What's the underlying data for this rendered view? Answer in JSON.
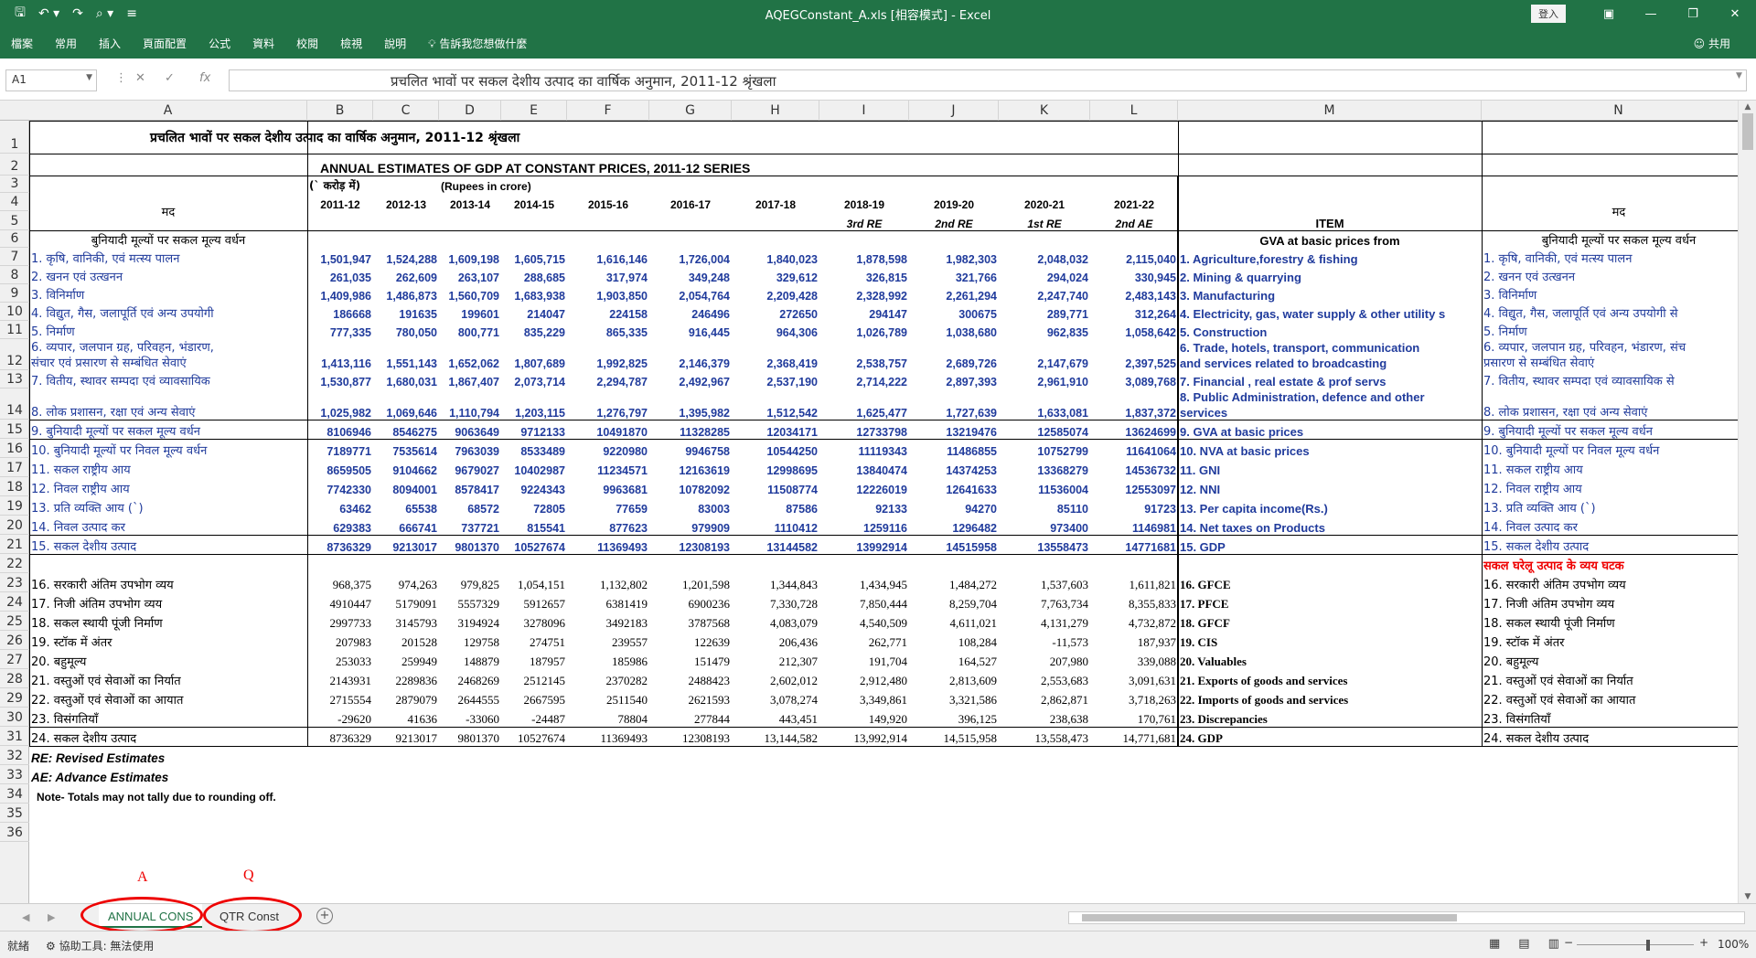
{
  "app": {
    "title": "AQEGConstant_A.xls [相容模式] - Excel",
    "signin": "登入",
    "share": "共用",
    "qa_icons": [
      "save-icon",
      "undo-icon",
      "redo-icon",
      "search-icon",
      "customize-icon"
    ],
    "window_controls": [
      "ribbon-display-icon",
      "minimize-icon",
      "restore-icon",
      "close-icon"
    ]
  },
  "ribbon": {
    "tabs": [
      "檔案",
      "常用",
      "插入",
      "頁面配置",
      "公式",
      "資料",
      "校閱",
      "檢視",
      "說明",
      "告訴我您想做什麼"
    ]
  },
  "formulabar": {
    "namebox": "A1",
    "formula": "प्रचलित भावों पर सकल देशीय उत्पाद का वार्षिक अनुमान, 2011-12 श्रृंखला"
  },
  "columns": [
    "A",
    "B",
    "C",
    "D",
    "E",
    "F",
    "G",
    "H",
    "I",
    "J",
    "K",
    "L",
    "M",
    "N"
  ],
  "rows": [
    "1",
    "2",
    "3",
    "4",
    "5",
    "6",
    "7",
    "8",
    "9",
    "10",
    "11",
    "12",
    "13",
    "14",
    "15",
    "16",
    "17",
    "18",
    "19",
    "20",
    "21",
    "22",
    "23",
    "24",
    "25",
    "26",
    "27",
    "28",
    "29",
    "30",
    "31",
    "32",
    "33",
    "34",
    "35",
    "36"
  ],
  "sheet": {
    "title_hi": "प्रचलित भावों पर सकल देशीय उत्पाद का वार्षिक अनुमान, 2011-12 श्रृंखला",
    "title_en": "ANNUAL ESTIMATES OF GDP AT CONSTANT PRICES,  2011-12 SERIES",
    "unit_hi": "(` करोड़ में)",
    "unit_en": "(Rupees in crore)",
    "mad": "मद",
    "item": "ITEM",
    "years": [
      "2011-12",
      "2012-13",
      "2013-14",
      "2014-15",
      "2015-16",
      "2016-17",
      "2017-18",
      "2018-19",
      "2019-20",
      "2020-21",
      "2021-22"
    ],
    "year_notes": [
      "",
      "",
      "",
      "",
      "",
      "",
      "",
      "3rd RE",
      "2nd RE",
      "1st RE",
      "2nd AE"
    ],
    "gva_hi": "बुनियादी मूल्यों पर सकल मूल्य वर्धन",
    "gva_en": "GVA at basic prices from",
    "section2_hi": "सकल घरेलू उत्पाद के व्यय घटक",
    "rows": [
      {
        "hi": "1. कृषि, वानिकी, एवं मत्स्य पालन",
        "hi_n": "1. कृषि, वानिकी, एवं मत्स्य पालन",
        "en": "1.  Agriculture,forestry & fishing",
        "vals": [
          "1,501,947",
          "1,524,288",
          "1,609,198",
          "1,605,715",
          "1,616,146",
          "1,726,004",
          "1,840,023",
          "1,878,598",
          "1,982,303",
          "2,048,032",
          "2,115,040"
        ]
      },
      {
        "hi": "2. खनन एवं उत्खनन",
        "hi_n": "2. खनन एवं उत्खनन",
        "en": "2.  Mining & quarrying",
        "vals": [
          "261,035",
          "262,609",
          "263,107",
          "288,685",
          "317,974",
          "349,248",
          "329,612",
          "326,815",
          "321,766",
          "294,024",
          "330,945"
        ]
      },
      {
        "hi": "3. विनिर्माण",
        "hi_n": "3. विनिर्माण",
        "en": "3.  Manufacturing",
        "vals": [
          "1,409,986",
          "1,486,873",
          "1,560,709",
          "1,683,938",
          "1,903,850",
          "2,054,764",
          "2,209,428",
          "2,328,992",
          "2,261,294",
          "2,247,740",
          "2,483,143"
        ]
      },
      {
        "hi": "4. विद्युत, गैस, जलापूर्ति एवं अन्य उपयोगी",
        "hi_n": "4. विद्युत, गैस, जलापूर्ति एवं अन्य उपयोगी से",
        "en": "4.  Electricity, gas, water supply & other utility s",
        "vals": [
          "186668",
          "191635",
          "199601",
          "214047",
          "224158",
          "246496",
          "272650",
          "294147",
          "300675",
          "289,771",
          "312,264"
        ]
      },
      {
        "hi": "5. निर्माण",
        "hi_n": "5. निर्माण",
        "en": "5.  Construction",
        "vals": [
          "777,335",
          "780,050",
          "800,771",
          "835,229",
          "865,335",
          "916,445",
          "964,306",
          "1,026,789",
          "1,038,680",
          "962,835",
          "1,058,642"
        ]
      },
      {
        "hi": "6. व्यपार, जलपान ग्रह, परिवहन, भंडारण,",
        "hi2": "संचार एवं प्रसारण से सम्बंधित सेवाएं",
        "hi_n": "6. व्यपार, जलपान ग्रह, परिवहन, भंडारण, संच",
        "hi_n2": "प्रसारण से सम्बंधित सेवाएं",
        "en": "6.  Trade, hotels, transport, communication",
        "en2": "and services related to broadcasting",
        "vals": [
          "1,413,116",
          "1,551,143",
          "1,652,062",
          "1,807,689",
          "1,992,825",
          "2,146,379",
          "2,368,419",
          "2,538,757",
          "2,689,726",
          "2,147,679",
          "2,397,525"
        ]
      },
      {
        "hi": "7. वितीय, स्थावर सम्पदा एवं व्यावसायिक",
        "hi_n": "7. वितीय, स्थावर सम्पदा एवं व्यावसायिक से",
        "en": "7. Financial , real estate & prof servs",
        "vals": [
          "1,530,877",
          "1,680,031",
          "1,867,407",
          "2,073,714",
          "2,294,787",
          "2,492,967",
          "2,537,190",
          "2,714,222",
          "2,897,393",
          "2,961,910",
          "3,089,768"
        ]
      },
      {
        "hi": "8. लोक प्रशासन, रक्षा एवं अन्य सेवाएं",
        "hi_n": "8. लोक प्रशासन, रक्षा एवं अन्य सेवाएं",
        "en": "8.  Public Administration, defence and other",
        "en2": "services",
        "vals": [
          "1,025,982",
          "1,069,646",
          "1,110,794",
          "1,203,115",
          "1,276,797",
          "1,395,982",
          "1,512,542",
          "1,625,477",
          "1,727,639",
          "1,633,081",
          "1,837,372"
        ]
      },
      {
        "hi": "9. बुनियादी मूल्यों पर सकल मूल्य वर्धन",
        "hi_n": "9. बुनियादी मूल्यों पर सकल मूल्य वर्धन",
        "en": "9. GVA at basic prices",
        "vals": [
          "8106946",
          "8546275",
          "9063649",
          "9712133",
          "10491870",
          "11328285",
          "12034171",
          "12733798",
          "13219476",
          "12585074",
          "13624699"
        ]
      },
      {
        "hi": "10. बुनियादी मूल्यों पर निवल मूल्य वर्धन",
        "hi_n": "10. बुनियादी मूल्यों पर निवल मूल्य वर्धन",
        "en": "10. NVA at basic prices",
        "vals": [
          "7189771",
          "7535614",
          "7963039",
          "8533489",
          "9220980",
          "9946758",
          "10544250",
          "11119343",
          "11486855",
          "10752799",
          "11641064"
        ]
      },
      {
        "hi": "11. सकल राष्ट्रीय आय",
        "hi_n": "11. सकल राष्ट्रीय आय",
        "en": "11. GNI",
        "vals": [
          "8659505",
          "9104662",
          "9679027",
          "10402987",
          "11234571",
          "12163619",
          "12998695",
          "13840474",
          "14374253",
          "13368279",
          "14536732"
        ]
      },
      {
        "hi": "12. निवल राष्ट्रीय आय",
        "hi_n": "12. निवल राष्ट्रीय आय",
        "en": "12. NNI",
        "vals": [
          "7742330",
          "8094001",
          "8578417",
          "9224343",
          "9963681",
          "10782092",
          "11508774",
          "12226019",
          "12641633",
          "11536004",
          "12553097"
        ]
      },
      {
        "hi": "13. प्रति व्यक्ति आय (`)",
        "hi_n": "13. प्रति व्यक्ति आय (`)",
        "en": "13. Per capita income(Rs.)",
        "vals": [
          "63462",
          "65538",
          "68572",
          "72805",
          "77659",
          "83003",
          "87586",
          "92133",
          "94270",
          "85110",
          "91723"
        ]
      },
      {
        "hi": "14. निवल उत्पाद कर",
        "hi_n": "14. निवल उत्पाद कर",
        "en": "14. Net taxes on Products",
        "vals": [
          "629383",
          "666741",
          "737721",
          "815541",
          "877623",
          "979909",
          "1110412",
          "1259116",
          "1296482",
          "973400",
          "1146981"
        ]
      },
      {
        "hi": "15. सकल देशीय उत्पाद",
        "hi_n": "15. सकल देशीय उत्पाद",
        "en": "15. GDP",
        "vals": [
          "8736329",
          "9213017",
          "9801370",
          "10527674",
          "11369493",
          "12308193",
          "13144582",
          "13992914",
          "14515958",
          "13558473",
          "14771681"
        ]
      }
    ],
    "exp_rows": [
      {
        "hi": "16. सरकारी अंतिम उपभोग व्यय",
        "en": "16. GFCE",
        "vals": [
          "968,375",
          "974,263",
          "979,825",
          "1,054,151",
          "1,132,802",
          "1,201,598",
          "1,344,843",
          "1,434,945",
          "1,484,272",
          "1,537,603",
          "1,611,821"
        ]
      },
      {
        "hi": "17. निजी अंतिम उपभोग व्यय",
        "en": "17. PFCE",
        "vals": [
          "4910447",
          "5179091",
          "5557329",
          "5912657",
          "6381419",
          "6900236",
          "7,330,728",
          "7,850,444",
          "8,259,704",
          "7,763,734",
          "8,355,833"
        ]
      },
      {
        "hi": "18. सकल स्थायी पूंजी निर्माण",
        "en": "18. GFCF",
        "vals": [
          "2997733",
          "3145793",
          "3194924",
          "3278096",
          "3492183",
          "3787568",
          "4,083,079",
          "4,540,509",
          "4,611,021",
          "4,131,279",
          "4,732,872"
        ]
      },
      {
        "hi": "19. स्टॉक में अंतर",
        "en": "19. CIS",
        "vals": [
          "207983",
          "201528",
          "129758",
          "274751",
          "239557",
          "122639",
          "206,436",
          "262,771",
          "108,284",
          "-11,573",
          "187,937"
        ]
      },
      {
        "hi": "20. बहुमूल्य",
        "en": "20. Valuables",
        "vals": [
          "253033",
          "259949",
          "148879",
          "187957",
          "185986",
          "151479",
          "212,307",
          "191,704",
          "164,527",
          "207,980",
          "339,088"
        ]
      },
      {
        "hi": "21. वस्तुओं एवं सेवाओं का निर्यात",
        "en": "21. Exports of goods and services",
        "vals": [
          "2143931",
          "2289836",
          "2468269",
          "2512145",
          "2370282",
          "2488423",
          "2,602,012",
          "2,912,480",
          "2,813,609",
          "2,553,683",
          "3,091,631"
        ]
      },
      {
        "hi": "22. वस्तुओं एवं सेवाओं का आयात",
        "en": "22. Imports of goods and services",
        "vals": [
          "2715554",
          "2879079",
          "2644555",
          "2667595",
          "2511540",
          "2621593",
          "3,078,274",
          "3,349,861",
          "3,321,586",
          "2,862,871",
          "3,718,263"
        ]
      },
      {
        "hi": "23. विसंगतियाँ",
        "en": "23. Discrepancies",
        "vals": [
          "-29620",
          "41636",
          "-33060",
          "-24487",
          "78804",
          "277844",
          "443,451",
          "149,920",
          "396,125",
          "238,638",
          "170,761"
        ]
      },
      {
        "hi": "24. सकल देशीय उत्पाद",
        "en": "24.  GDP",
        "vals": [
          "8736329",
          "9213017",
          "9801370",
          "10527674",
          "11369493",
          "12308193",
          "13,144,582",
          "13,992,914",
          "14,515,958",
          "13,558,473",
          "14,771,681"
        ]
      }
    ],
    "notes": [
      "RE: Revised Estimates",
      "AE: Advance Estimates",
      "Note- Totals may not tally due to rounding off."
    ]
  },
  "tabs": {
    "sheets": [
      "ANNUAL CONS",
      "QTR Const"
    ],
    "annotations": [
      "A",
      "Q"
    ]
  },
  "status": {
    "ready": "就緒",
    "accessibility": "協助工具: 無法使用",
    "zoom": "100%"
  },
  "colors": {
    "excel_green": "#217346",
    "blue_text": "#203b9c",
    "annotation_red": "#ee0000"
  }
}
